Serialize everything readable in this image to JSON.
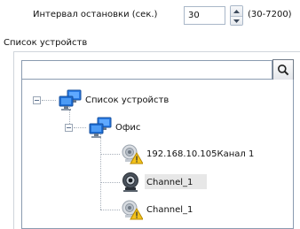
{
  "settings": {
    "interval_label": "Интервал остановки (сек.)",
    "interval_value": "30",
    "interval_range": "(30-7200)"
  },
  "device_list": {
    "group_title": "Список устройств",
    "search": {
      "value": "",
      "placeholder": ""
    },
    "tree": {
      "root": {
        "label": "Список устройств",
        "icon": "network-computers-icon",
        "expanded": true,
        "children": [
          {
            "label": "Офис",
            "icon": "network-computers-icon",
            "expanded": true,
            "children": [
              {
                "label": "192.168.10.105Канал 1",
                "icon": "camera-warning-icon",
                "selected": false
              },
              {
                "label": "Channel_1",
                "icon": "camera-icon",
                "selected": true
              },
              {
                "label": "Channel_1",
                "icon": "camera-warning-icon",
                "selected": false
              }
            ]
          }
        ]
      }
    }
  },
  "colors": {
    "border": "#8a9bb0",
    "selection": "#e7e7e7",
    "computer_blue": "#1f6fd6",
    "warning_yellow": "#f3c21b"
  }
}
